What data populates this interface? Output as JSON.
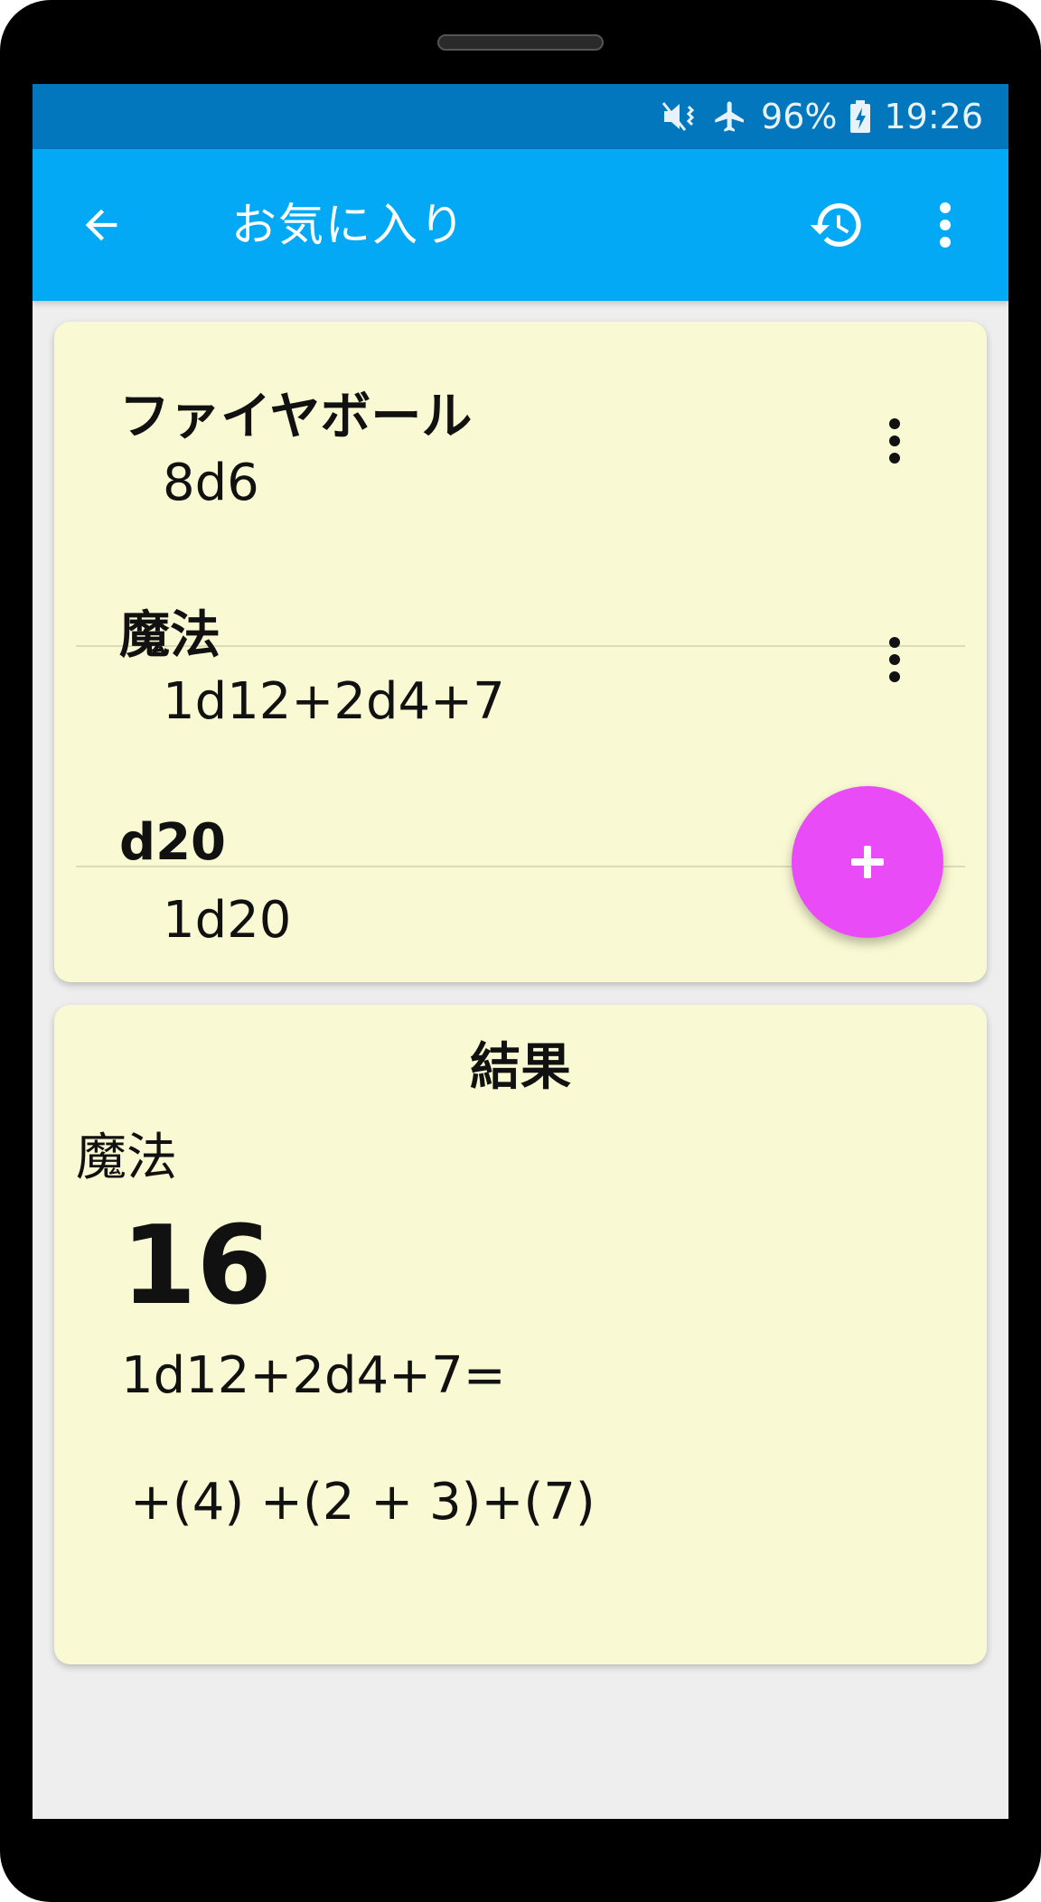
{
  "status_bar": {
    "battery": "96%",
    "time": "19:26",
    "icons": [
      "vibrate-mute-icon",
      "airplane-mode-icon",
      "battery-charging-icon"
    ]
  },
  "toolbar": {
    "title": "お気に入り",
    "back_icon": "arrow-back-icon",
    "history_icon": "history-icon",
    "more_icon": "more-vert-icon",
    "color": "#03a9f4"
  },
  "favorites": [
    {
      "name": "ファイヤボール",
      "formula": "8d6"
    },
    {
      "name": "魔法",
      "formula": "1d12+2d4+7"
    },
    {
      "name": "d20",
      "formula": "1d20"
    }
  ],
  "fab": {
    "icon": "plus-icon",
    "color": "#e94cf6"
  },
  "result": {
    "heading": "結果",
    "name": "魔法",
    "total": "16",
    "expression": "1d12+2d4+7=",
    "detail": "+(4) +(2 + 3)+(7)"
  },
  "colors": {
    "status_bar": "#0277bd",
    "card_background": "#f9f9d3",
    "screen_background": "#eeeeee"
  }
}
